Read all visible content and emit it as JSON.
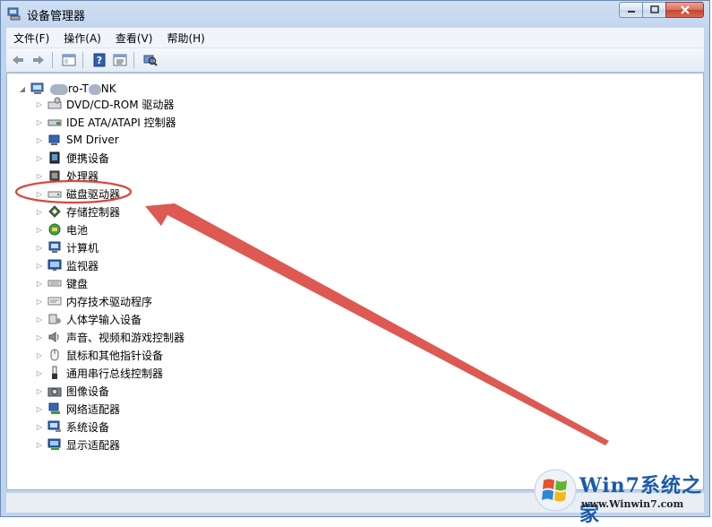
{
  "window": {
    "title": "设备管理器"
  },
  "menubar": {
    "items": [
      "文件(F)",
      "操作(A)",
      "查看(V)",
      "帮助(H)"
    ]
  },
  "tree": {
    "root_prefix": "",
    "root_visible": "ro-T",
    "root_suffix": "NK",
    "nodes": [
      {
        "label": "DVD/CD-ROM 驱动器",
        "icon": "dvd-drive-icon"
      },
      {
        "label": "IDE ATA/ATAPI 控制器",
        "icon": "ide-controller-icon"
      },
      {
        "label": "SM Driver",
        "icon": "sm-driver-icon"
      },
      {
        "label": "便携设备",
        "icon": "portable-device-icon"
      },
      {
        "label": "处理器",
        "icon": "processor-icon"
      },
      {
        "label": "磁盘驱动器",
        "icon": "disk-drive-icon"
      },
      {
        "label": "存储控制器",
        "icon": "storage-controller-icon"
      },
      {
        "label": "电池",
        "icon": "battery-icon"
      },
      {
        "label": "计算机",
        "icon": "computer-icon"
      },
      {
        "label": "监视器",
        "icon": "monitor-icon"
      },
      {
        "label": "键盘",
        "icon": "keyboard-icon"
      },
      {
        "label": "内存技术驱动程序",
        "icon": "memory-technology-icon"
      },
      {
        "label": "人体学输入设备",
        "icon": "hid-icon"
      },
      {
        "label": "声音、视频和游戏控制器",
        "icon": "sound-icon"
      },
      {
        "label": "鼠标和其他指针设备",
        "icon": "mouse-icon"
      },
      {
        "label": "通用串行总线控制器",
        "icon": "usb-icon"
      },
      {
        "label": "图像设备",
        "icon": "imaging-device-icon"
      },
      {
        "label": "网络适配器",
        "icon": "network-adapter-icon"
      },
      {
        "label": "系统设备",
        "icon": "system-device-icon"
      },
      {
        "label": "显示适配器",
        "icon": "display-adapter-icon"
      }
    ]
  },
  "watermark": {
    "title": "Win7系统之家",
    "url": "www.Winwin7.com"
  },
  "colors": {
    "annotation": "#d9473f",
    "titlebar": "#c3d6ef",
    "close": "#c7442c"
  }
}
